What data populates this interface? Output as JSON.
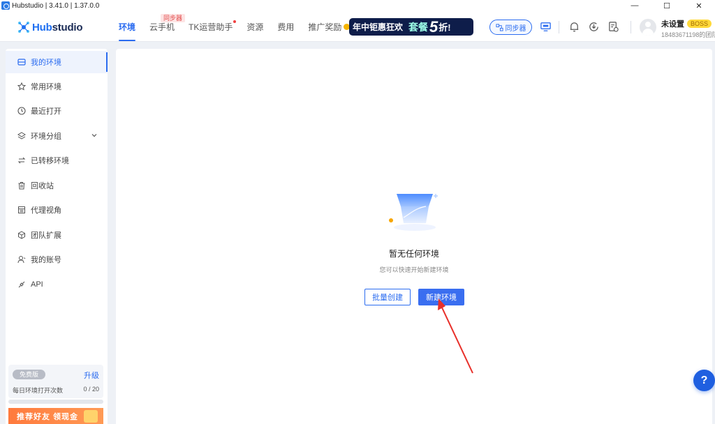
{
  "window": {
    "title": "Hubstudio | 3.41.0 | 1.37.0.0",
    "controls": [
      "—",
      "☐",
      "✕"
    ]
  },
  "logo": {
    "prefix": "",
    "brand": "Hub",
    "suffix": "studio"
  },
  "nav": {
    "items": [
      {
        "label": "环境",
        "active": true
      },
      {
        "label": "云手机",
        "badge": "同步器"
      },
      {
        "label": "TK运营助手",
        "dot": true
      },
      {
        "label": "资源"
      },
      {
        "label": "费用"
      },
      {
        "label": "推广奖励",
        "coin": true
      }
    ]
  },
  "promo": {
    "text1": "年中钜惠狂欢",
    "text2": "套餐",
    "number": "5",
    "text3": "折!"
  },
  "header": {
    "sync_button": "同步器",
    "user_name": "未设置",
    "user_badge": "BOSS",
    "user_id": "18483671198的团队"
  },
  "sidebar": {
    "items": [
      {
        "label": "我的环境",
        "icon": "monitor-icon",
        "active": true
      },
      {
        "label": "常用环境",
        "icon": "star-icon"
      },
      {
        "label": "最近打开",
        "icon": "clock-icon"
      },
      {
        "label": "环境分组",
        "icon": "layers-icon",
        "expandable": true
      },
      {
        "label": "已转移环境",
        "icon": "transfer-icon"
      },
      {
        "label": "回收站",
        "icon": "trash-icon"
      },
      {
        "label": "代理视角",
        "icon": "proxy-icon"
      },
      {
        "label": "团队扩展",
        "icon": "cube-icon"
      },
      {
        "label": "我的账号",
        "icon": "user-icon"
      },
      {
        "label": "API",
        "icon": "api-icon"
      }
    ],
    "plan": {
      "badge": "免费版",
      "upgrade": "升级",
      "usage_label": "每日环境打开次数",
      "usage_count": "0 / 20",
      "usage_fraction": 0
    },
    "refer_banner": "推荐好友 领现金"
  },
  "main": {
    "empty_title": "暂无任何环境",
    "empty_subtitle": "您可以快速开始新建环境",
    "batch_create": "批量创建",
    "new_env": "新建环境"
  },
  "help": "?",
  "colors": {
    "accent": "#2b6cf0",
    "arrow": "#e8302a",
    "promo_bg": "#0e1d4a"
  }
}
